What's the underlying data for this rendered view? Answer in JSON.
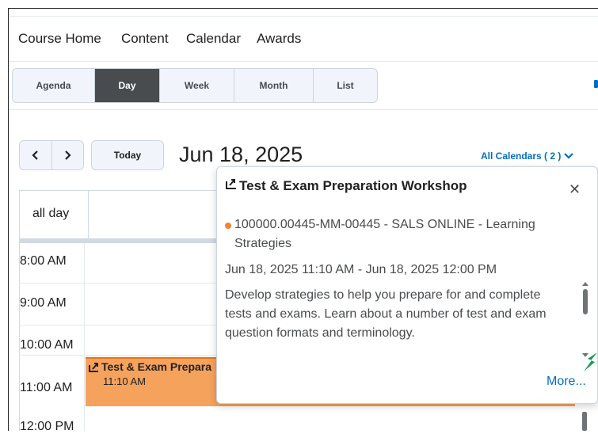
{
  "nav": {
    "items": [
      "Course Home",
      "Content",
      "Calendar",
      "Awards"
    ]
  },
  "views": {
    "tabs": [
      "Agenda",
      "Day",
      "Week",
      "Month",
      "List"
    ],
    "active": "Day"
  },
  "toolbar": {
    "prev_icon": "chevron-left",
    "next_icon": "chevron-right",
    "today_label": "Today",
    "date_title": "Jun 18, 2025",
    "calendars_label": "All Calendars ( 2 )"
  },
  "grid": {
    "all_day_label": "all day",
    "hours": [
      "8:00 AM",
      "9:00 AM",
      "10:00 AM",
      "11:00 AM",
      "12:00 PM"
    ]
  },
  "event": {
    "title": "Test & Exam Prepara",
    "time": "11:10 AM",
    "color": "#f5a25d"
  },
  "popover": {
    "title": "Test & Exam Preparation Workshop",
    "close_icon": "close",
    "calendar_line1": "100000.00445-MM-00445 - SALS ONLINE - Learning",
    "calendar_line2": "Strategies",
    "datetime": "Jun 18, 2025 11:10 AM - Jun 18, 2025 12:00 PM",
    "description": [
      "Develop strategies to help you prepare for and complete",
      "tests and exams. Learn about a number of test and exam",
      "question formats and terminology."
    ],
    "more_label": "More..."
  },
  "colors": {
    "accent": "#006fbf",
    "active_tab": "#494c4e",
    "event_dot": "#f58230"
  }
}
